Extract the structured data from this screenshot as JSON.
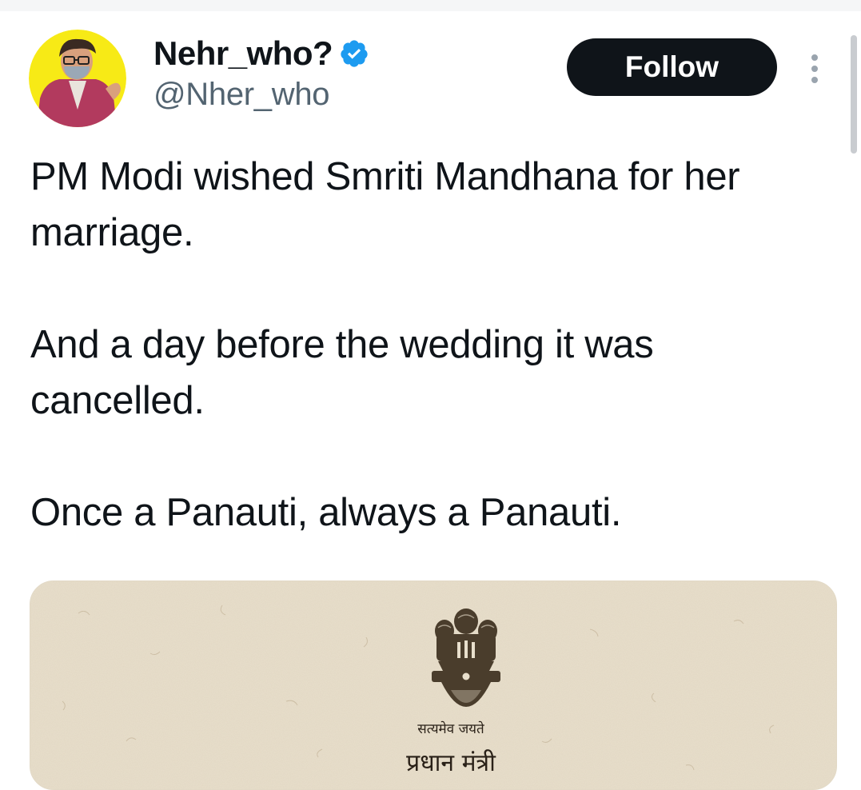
{
  "author": {
    "display_name": "Nehr_who?",
    "handle": "@Nher_who",
    "verified": true,
    "avatar_icon": "profile-avatar"
  },
  "actions": {
    "follow_label": "Follow",
    "more_icon": "more-vertical-icon"
  },
  "tweet": {
    "paragraphs": [
      "PM Modi wished Smriti Mandhana for her marriage.",
      "And a day before the wedding it was cancelled.",
      "Once a Panauti, always a Panauti."
    ]
  },
  "media": {
    "emblem_icon": "national-emblem-icon",
    "motto": "सत्यमेव जयते",
    "office_title": "प्रधान मंत्री"
  },
  "colors": {
    "text": "#0f1419",
    "secondary_text": "#536471",
    "verified_blue": "#1d9bf0",
    "follow_bg": "#0f1419",
    "paper": "#e8dfcc"
  }
}
